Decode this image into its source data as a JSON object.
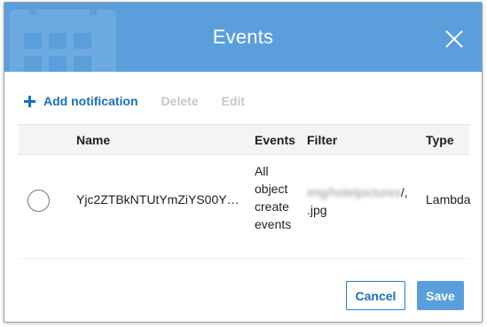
{
  "dialog": {
    "title": "Events",
    "close_icon": "close-icon"
  },
  "toolbar": {
    "add_label": "Add notification",
    "delete_label": "Delete",
    "edit_label": "Edit"
  },
  "table": {
    "columns": [
      "Name",
      "Events",
      "Filter",
      "Type"
    ],
    "rows": [
      {
        "name": "Yjc2ZTBkNTUtYmZiYS00Y…",
        "events": [
          "All",
          "object",
          "create",
          "events"
        ],
        "filter_prefix": "img/hotelpictures",
        "filter_slash": "/,",
        "filter_suffix": ".jpg",
        "type": "Lambda"
      }
    ]
  },
  "footer": {
    "cancel_label": "Cancel",
    "save_label": "Save"
  },
  "colors": {
    "header": "#5a9fdc",
    "link": "#1b6fc2",
    "disabled": "#c3c7cc"
  }
}
